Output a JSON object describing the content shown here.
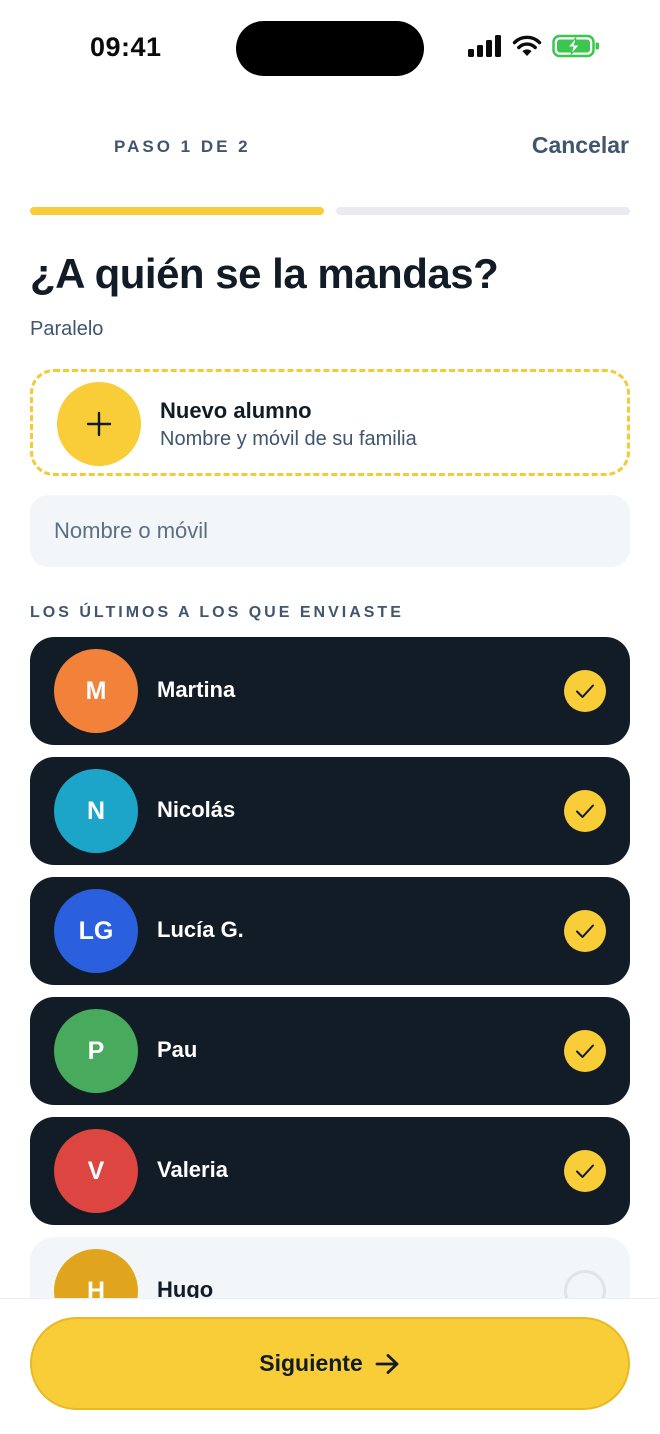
{
  "status_bar": {
    "time": "09:41"
  },
  "header": {
    "step": "PASO 1 DE 2",
    "cancel_label": "Cancelar"
  },
  "progress": {
    "current_step": 1,
    "total_steps": 2
  },
  "title": "¿A quién se la mandas?",
  "subtitle": "Paralelo",
  "new_student": {
    "title": "Nuevo alumno",
    "subtitle": "Nombre y móvil de su familia",
    "icon": "plus-icon"
  },
  "search": {
    "placeholder": "Nombre o móvil",
    "value": ""
  },
  "recent_section_label": "LOS ÚLTIMOS A LOS QUE ENVIASTE",
  "students": [
    {
      "initials": "M",
      "name": "Martina",
      "color": "#f2813a",
      "selected": true
    },
    {
      "initials": "N",
      "name": "Nicolás",
      "color": "#1da5c9",
      "selected": true
    },
    {
      "initials": "LG",
      "name": "Lucía G.",
      "color": "#2a5fdd",
      "selected": true
    },
    {
      "initials": "P",
      "name": "Pau",
      "color": "#48aa5d",
      "selected": true
    },
    {
      "initials": "V",
      "name": "Valeria",
      "color": "#dc4540",
      "selected": true
    },
    {
      "initials": "H",
      "name": "Hugo",
      "color": "#e0a51c",
      "selected": false
    }
  ],
  "footer": {
    "next_label": "Siguiente",
    "next_icon": "arrow-right-icon"
  },
  "colors": {
    "accent": "#f8cd38",
    "dark": "#121c26",
    "muted": "#40556e",
    "surface": "#f3f6f8"
  }
}
